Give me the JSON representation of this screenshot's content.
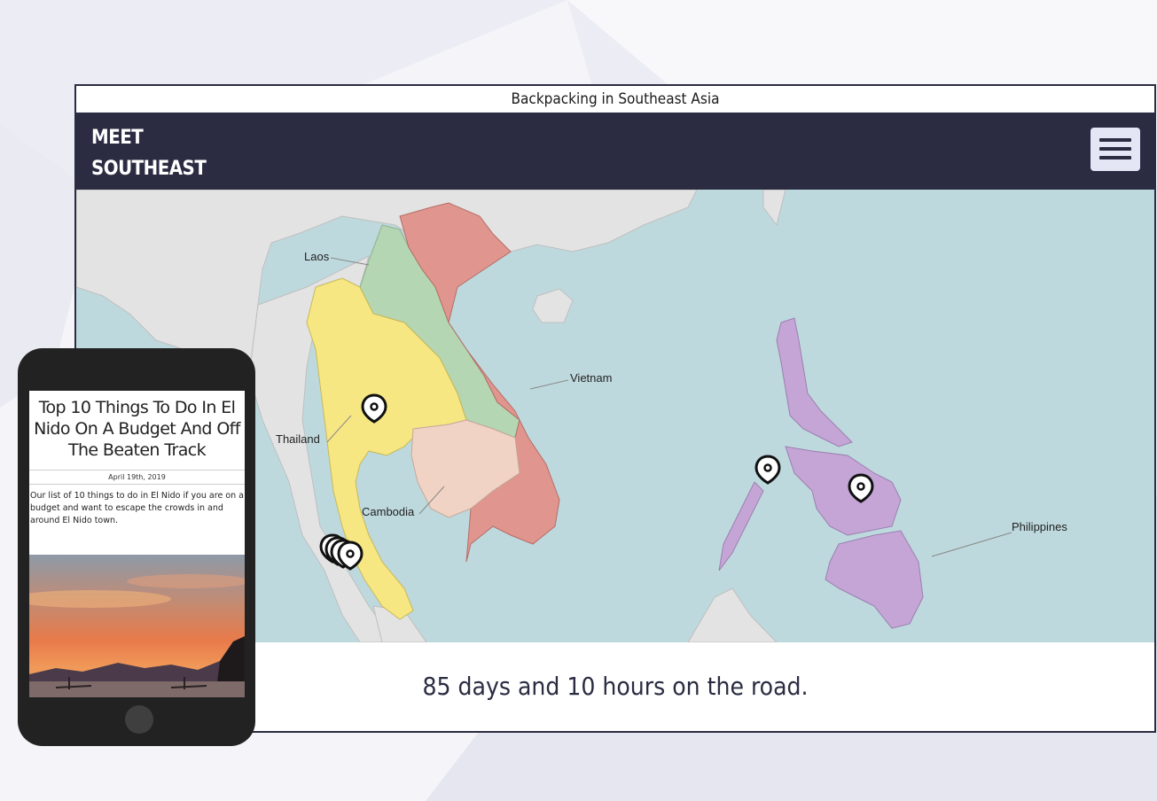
{
  "site": {
    "page_title": "Backpacking in Southeast Asia",
    "brand_line1": "MEET",
    "brand_line2": "SOUTHEAST",
    "menu_icon": "hamburger-menu-icon",
    "countdown_text": "85 days and 10 hours on the road."
  },
  "map": {
    "countries": [
      {
        "name": "Laos",
        "color": "#b5d6b3"
      },
      {
        "name": "Vietnam",
        "color": "#e0968e"
      },
      {
        "name": "Thailand",
        "color": "#f6e783"
      },
      {
        "name": "Cambodia",
        "color": "#f0d3c4"
      },
      {
        "name": "Philippines",
        "color": "#c4a5d6"
      }
    ],
    "marker_icon": "map-pin-icon",
    "marker_count": 7
  },
  "phone": {
    "article_title": "Top 10 Things To Do In El Nido On A Budget And Off The Beaten Track",
    "date": "April 19th, 2019",
    "excerpt": "Our list of 10 things to do in El Nido if you are on a budget and want to escape the crowds in and around El Nido town.",
    "home_button_icon": "home-button-icon"
  },
  "colors": {
    "navbar": "#2b2c42",
    "sea": "#bed9dd",
    "land": "#e3e3e3",
    "hamburger_bg": "#e4e6f6"
  }
}
